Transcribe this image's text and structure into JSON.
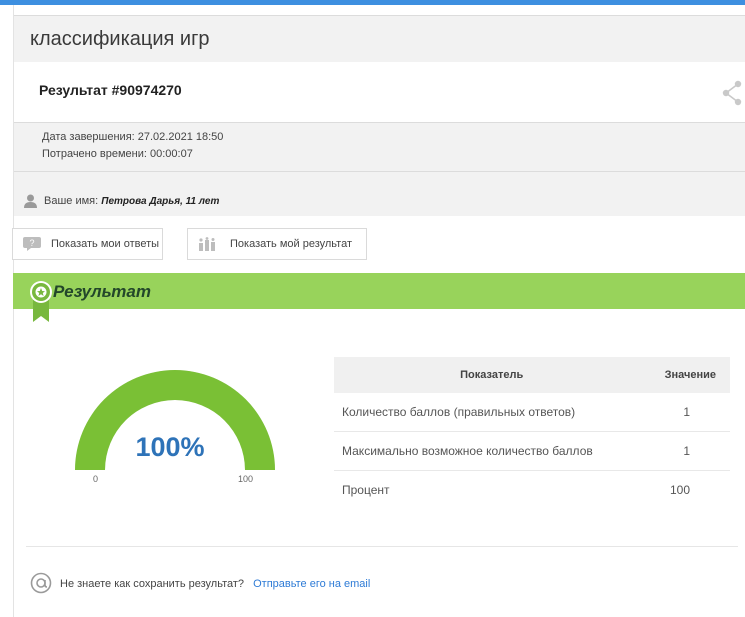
{
  "app": {
    "title": "классификация игр",
    "result_title": "Результат #90974270"
  },
  "info": {
    "completion_date": "Дата завершения: 27.02.2021 18:50",
    "time_spent": "Потрачено времени: 00:00:07",
    "name_label": "Ваше имя:",
    "name_value": "Петрова Дарья, 11 лет"
  },
  "buttons": {
    "show_answers": "Показать мои ответы",
    "show_result": "Показать мой результат"
  },
  "section": {
    "heading": "Результат"
  },
  "gauge": {
    "percent_label": "100%",
    "value": 100,
    "min_label": "0",
    "max_label": "100"
  },
  "metrics_table": {
    "headers": [
      "Показатель",
      "Значение"
    ],
    "rows": [
      [
        "Количество баллов (правильных ответов)",
        "1"
      ],
      [
        "Максимально возможное количество баллов",
        "1"
      ],
      [
        "Процент",
        "100"
      ]
    ]
  },
  "footer": {
    "question": "Не знаете как сохранить результат?",
    "link": "Отправьте его на email"
  },
  "colors": {
    "accent_blue": "#3d8fe0",
    "result_green": "#98d35b",
    "gauge_green": "#7ac035",
    "percent_blue": "#2e73b8",
    "link_blue": "#2e7bd6"
  }
}
